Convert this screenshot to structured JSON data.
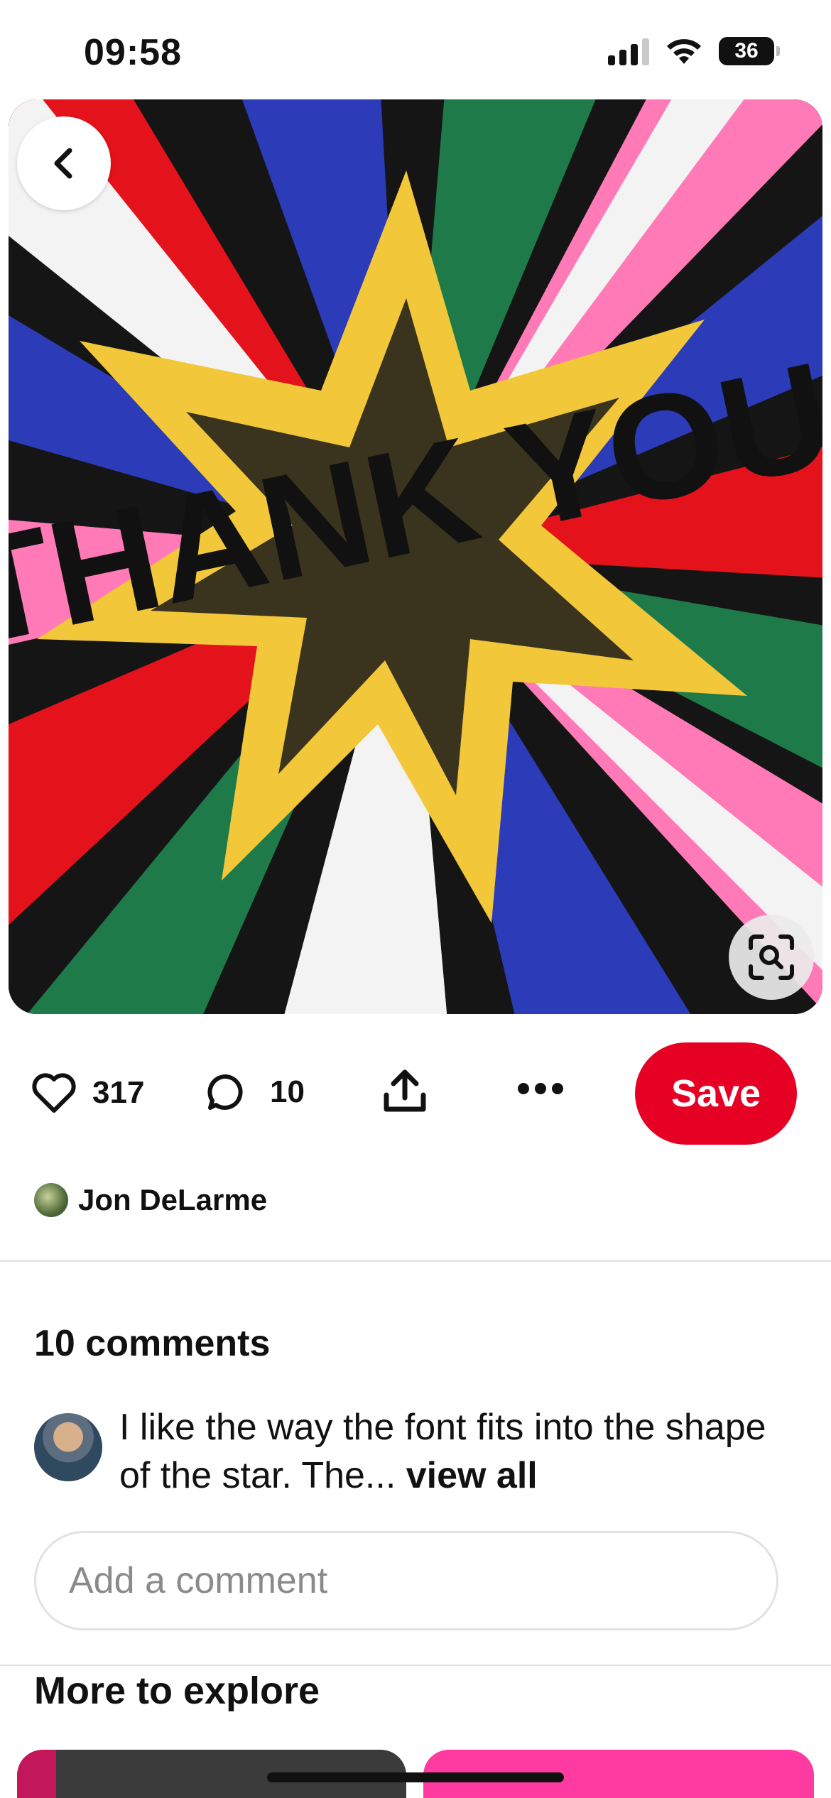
{
  "status_bar": {
    "time": "09:58",
    "battery": "36",
    "icons": [
      "signal-icon",
      "wifi-icon",
      "battery-icon"
    ]
  },
  "pin": {
    "image_text": "THANK YOU",
    "back_icon": "chevron-left-icon",
    "visual_search_icon": "visual-search-icon"
  },
  "actions": {
    "likes": "317",
    "comments": "10",
    "save_label": "Save",
    "icons": [
      "heart-icon",
      "comment-icon",
      "share-icon",
      "more-icon"
    ]
  },
  "creator": {
    "name": "Jon DeLarme"
  },
  "comments": {
    "title": "10 comments",
    "items": [
      {
        "text": "I like the way the font fits into the shape of the star. The...",
        "more": "view all"
      }
    ],
    "input_placeholder": "Add a comment"
  },
  "explore": {
    "title": "More to explore"
  },
  "colors": {
    "save": "#e60023",
    "text": "#111111",
    "placeholder": "#8a8a8a"
  }
}
